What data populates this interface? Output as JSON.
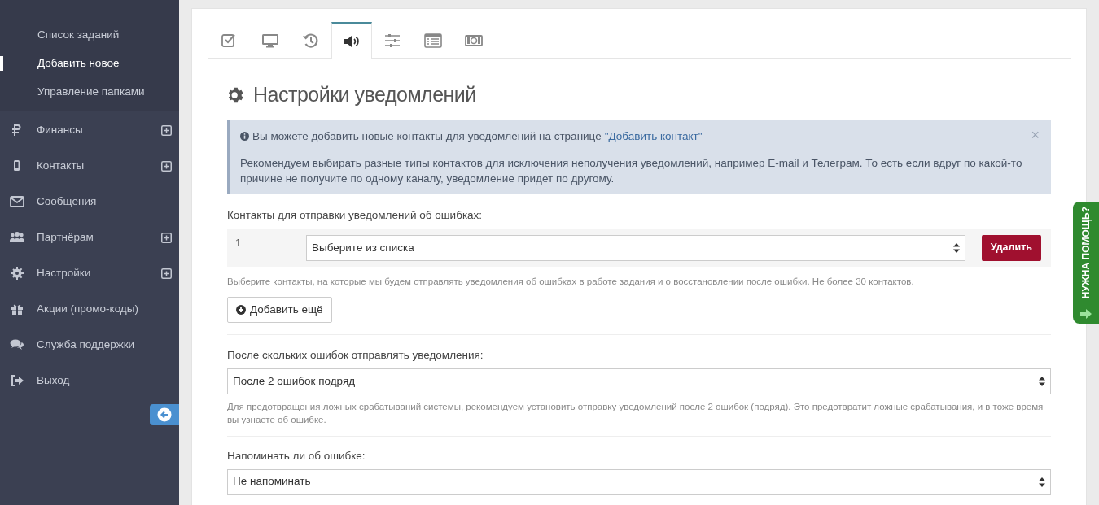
{
  "sidebar": {
    "subitems": [
      {
        "label": "Список заданий",
        "selected": false
      },
      {
        "label": "Добавить новое",
        "selected": true
      },
      {
        "label": "Управление папками",
        "selected": false
      }
    ],
    "items": [
      {
        "label": "Финансы",
        "expandable": true
      },
      {
        "label": "Контакты",
        "expandable": true
      },
      {
        "label": "Сообщения",
        "expandable": false
      },
      {
        "label": "Партнёрам",
        "expandable": true
      },
      {
        "label": "Настройки",
        "expandable": true
      },
      {
        "label": "Акции (промо-коды)",
        "expandable": false
      },
      {
        "label": "Служба поддержки",
        "expandable": false
      },
      {
        "label": "Выход",
        "expandable": false
      }
    ]
  },
  "tabs": [
    {
      "selected": false
    },
    {
      "selected": false
    },
    {
      "selected": false
    },
    {
      "selected": true
    },
    {
      "selected": false
    },
    {
      "selected": false
    },
    {
      "selected": false
    }
  ],
  "heading": "Настройки уведомлений",
  "alert": {
    "line1": "Вы можете добавить новые контакты для уведомлений на странице",
    "link": "\"Добавить контакт\"",
    "close": "×",
    "line2": "Рекомендуем выбирать разные типы контактов для исключения неполучения уведомлений, например E-mail и Телеграм. То есть если вдруг по какой-то причине не получите по одному каналу, уведомление придет по другому."
  },
  "contacts": {
    "label": "Контакты для отправки уведомлений об ошибках:",
    "rows": [
      {
        "number": "1",
        "value": "Выберите из списка",
        "delete": "Удалить"
      }
    ],
    "hint": "Выберите контакты, на которые мы будем отправлять уведомления об ошибках в работе задания и о восстановлении после ошибки. Не более 30 контактов.",
    "add": "Добавить ещё"
  },
  "after_errors": {
    "label": "После скольких ошибок отправлять уведомления:",
    "value": "После 2 ошибок подряд",
    "hint": "Для предотвращения ложных срабатываний системы, рекомендуем установить отправку уведомлений после 2 ошибок (подряд). Это предотвратит ложные срабатывания, и в тоже время вы узнаете об ошибке."
  },
  "remind": {
    "label": "Напоминать ли об ошибке:",
    "value": "Не напоминать"
  },
  "help_tab": "НУЖНА ПОМОЩЬ?"
}
